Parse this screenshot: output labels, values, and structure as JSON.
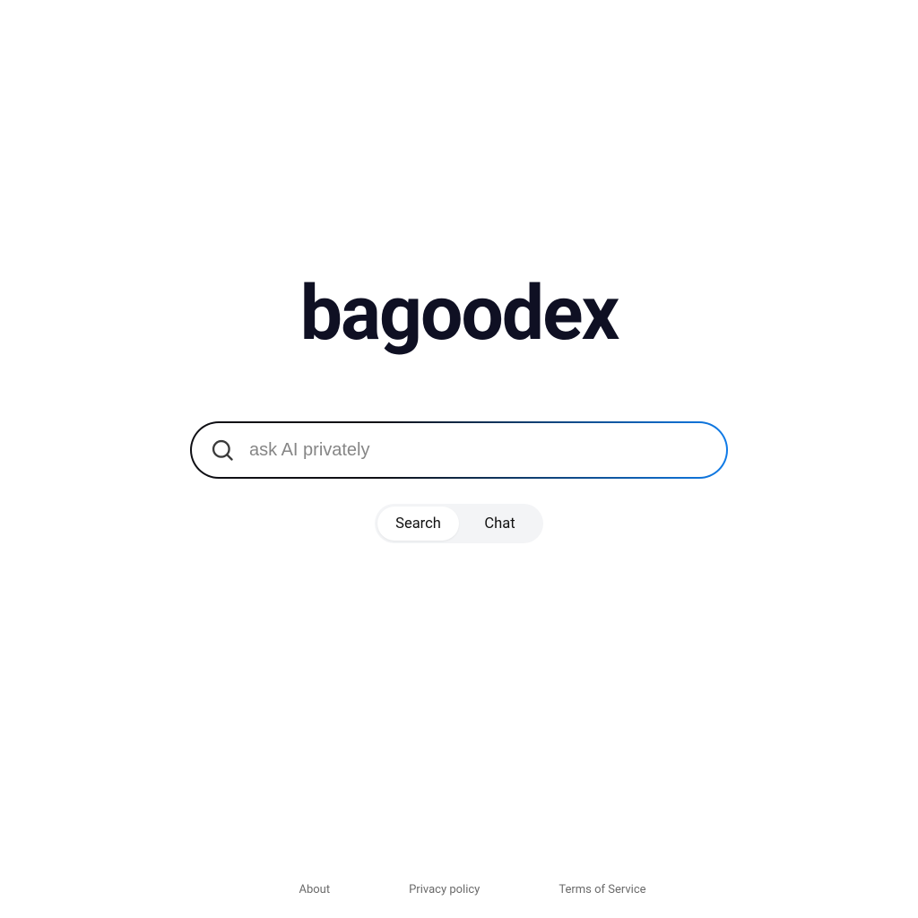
{
  "brand": {
    "name": "bagoodex"
  },
  "search": {
    "placeholder": "ask AI privately",
    "value": ""
  },
  "toggle": {
    "search_label": "Search",
    "chat_label": "Chat",
    "active": "search"
  },
  "footer": {
    "about": "About",
    "privacy": "Privacy policy",
    "terms": "Terms of Service"
  }
}
